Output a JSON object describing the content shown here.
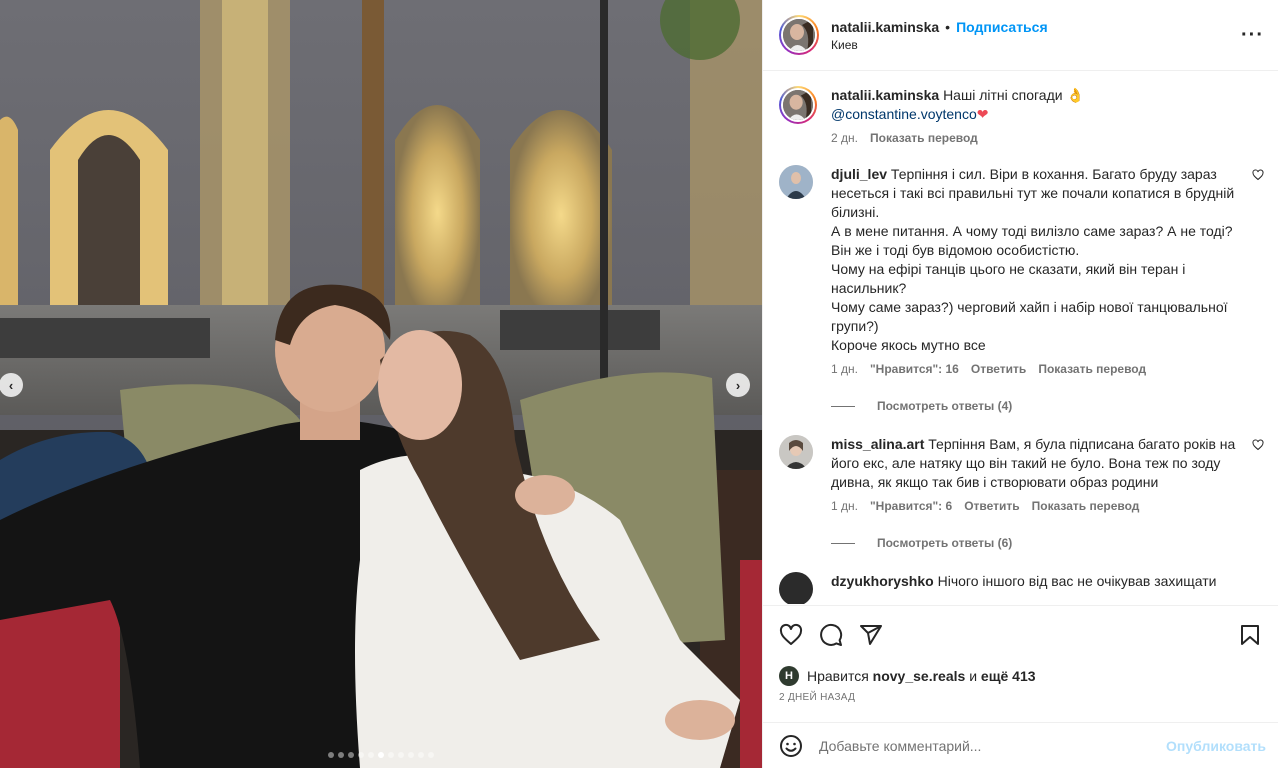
{
  "post": {
    "username": "natalii.kaminska",
    "separator": "•",
    "follow_label": "Подписаться",
    "location": "Киев",
    "more_icon": "more-horizontal-icon"
  },
  "caption": {
    "username": "natalii.kaminska",
    "text": "Наші літні спогади",
    "emoji": "👌",
    "mention": "@constantine.voytenco",
    "heart": "❤",
    "age": "2 дн.",
    "translate": "Показать перевод"
  },
  "comments": [
    {
      "username": "djuli_lev",
      "text": "Терпіння і сил. Віри в кохання. Багато бруду зараз несеться і такі всі правильні тут же почали копатися в брудній білизні.",
      "lines": [
        "А в мене питання. А чому тоді вилізло саме зараз? А не тоді? Він же і тоді був відомою особистістю.",
        "Чому на ефірі танців цього не сказати, який він теран і насильник?",
        "Чому саме зараз?) черговий хайп і набір нової танцювальної групи?)",
        "Короче якось мутно все"
      ],
      "age": "1 дн.",
      "likes": "\"Нравится\": 16",
      "reply": "Ответить",
      "translate": "Показать перевод",
      "replies": "Посмотреть ответы (4)"
    },
    {
      "username": "miss_alina.art",
      "text": "Терпіння Вам, я була підписана багато років на його екс, але натяку що він такий не було. Вона теж по зоду дивна, як якщо так бив і створювати образ родини",
      "age": "1 дн.",
      "likes": "\"Нравится\": 6",
      "reply": "Ответить",
      "translate": "Показать перевод",
      "replies": "Посмотреть ответы (6)"
    },
    {
      "username": "dzyukhoryshko",
      "text": "Нічого іншого від вас не очікував захищати"
    }
  ],
  "engagement": {
    "liked_by_avatar_letter": "H",
    "liked_by_prefix": "Нравится",
    "liked_by_user": "novy_se.reals",
    "liked_by_join": "и",
    "others": "ещё 413",
    "date": "2 ДНЕЙ НАЗАД"
  },
  "composer": {
    "placeholder": "Добавьте комментарий...",
    "post_label": "Опубликовать"
  },
  "carousel": {
    "prev": "‹",
    "next": "›",
    "total": 11,
    "active_index": 5
  },
  "colors": {
    "link": "#0095f6",
    "mention": "#00376b",
    "muted": "#737373",
    "publish_disabled": "#b2dffc"
  }
}
